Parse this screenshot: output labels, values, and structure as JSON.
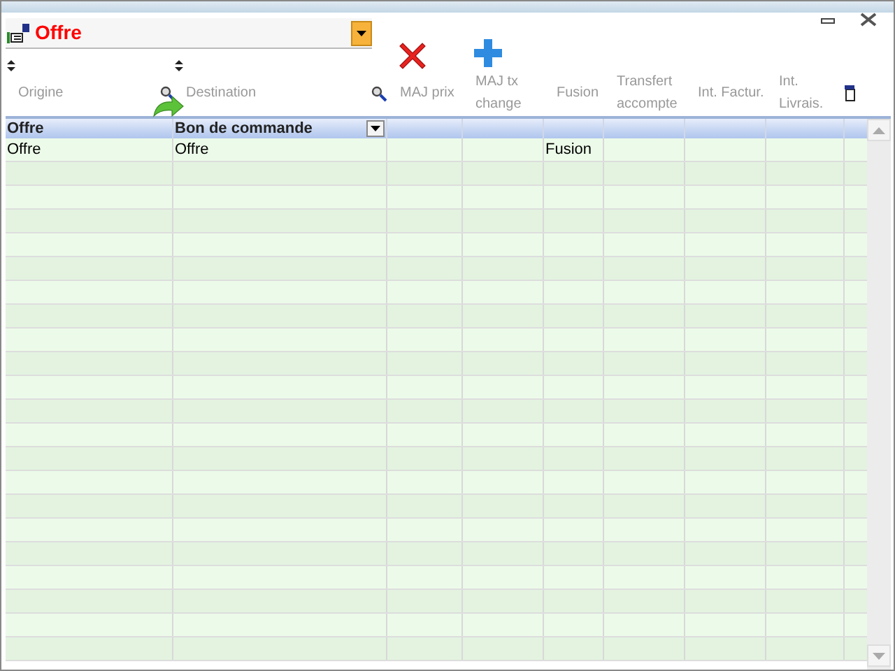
{
  "selector": {
    "value": "Offre"
  },
  "columns": [
    {
      "label": "Origine",
      "sortable": true,
      "searchable": false
    },
    {
      "label": "Destination",
      "sortable": true,
      "searchable": true
    },
    {
      "label": "MAJ prix",
      "sortable": false,
      "searchable": true
    },
    {
      "label": "MAJ tx change",
      "sortable": false,
      "searchable": false
    },
    {
      "label": "Fusion",
      "sortable": false,
      "searchable": false
    },
    {
      "label": "Transfert accompte",
      "sortable": false,
      "searchable": false
    },
    {
      "label": "Int. Factur.",
      "sortable": false,
      "searchable": false
    },
    {
      "label": "Int. Livrais.",
      "sortable": false,
      "searchable": false
    }
  ],
  "filter_row": {
    "selected": true,
    "cells": [
      "Offre",
      "Bon de commande",
      "",
      "",
      "",
      "",
      "",
      ""
    ]
  },
  "rows": [
    {
      "selected": false,
      "cells": [
        "Offre",
        "Offre",
        "",
        "",
        "Fusion",
        "",
        "",
        ""
      ]
    }
  ]
}
